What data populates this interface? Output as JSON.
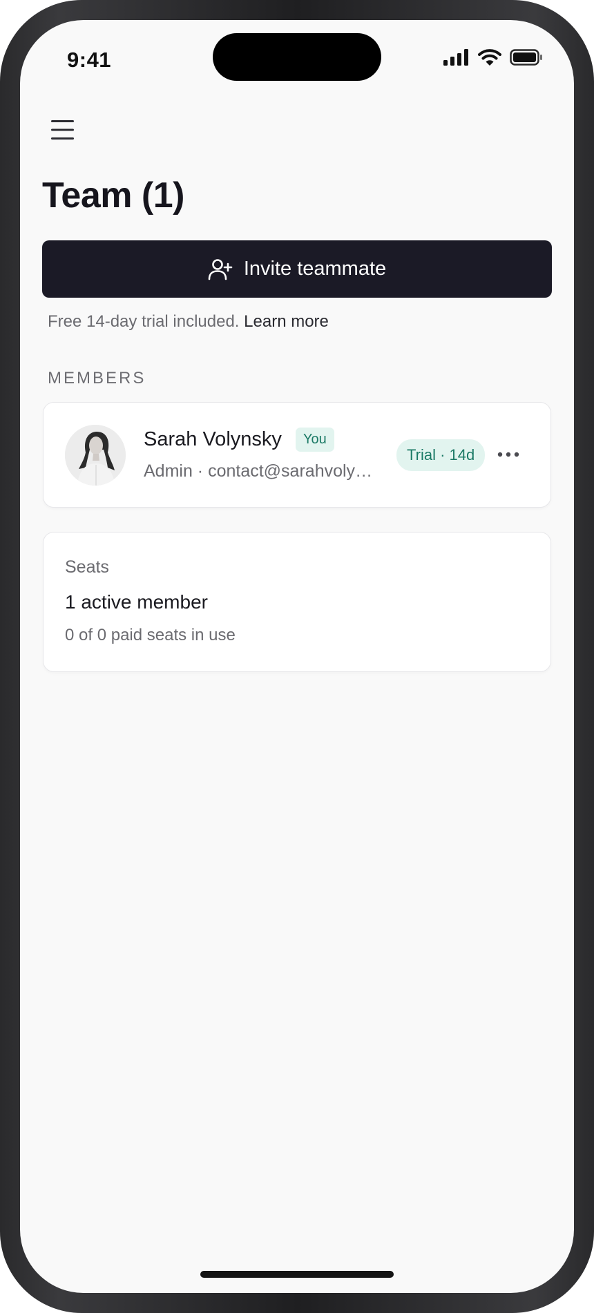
{
  "status_bar": {
    "time": "9:41",
    "icons": [
      "signal-icon",
      "wifi-icon",
      "battery-icon"
    ]
  },
  "header": {
    "menu_icon": "hamburger-menu-icon",
    "title": "Team (1)"
  },
  "invite": {
    "icon": "user-plus-icon",
    "label": "Invite teammate"
  },
  "trial_note": {
    "text": "Free 14-day trial included.",
    "link": "Learn more"
  },
  "members_section": {
    "label": "MEMBERS",
    "members": [
      {
        "name": "Sarah Volynsky",
        "badge": "You",
        "subtitle": "Admin · contact@sarahvolynsky.com",
        "status": "Trial · 14d",
        "more_icon": "more-horizontal-icon"
      }
    ]
  },
  "seats": {
    "label": "Seats",
    "active": "1 active member",
    "paid": "0 of 0 paid seats in use"
  },
  "colors": {
    "background": "#f9f9f9",
    "primary_button": "#1b1a26",
    "badge_bg": "#e2f4ef",
    "badge_text": "#1c7a66",
    "text_primary": "#1a1a20",
    "text_secondary": "#6b6b70"
  }
}
